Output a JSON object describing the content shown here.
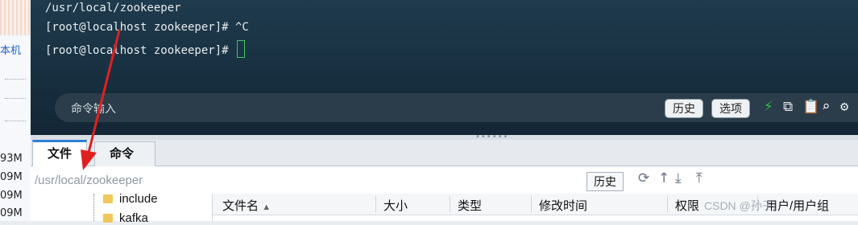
{
  "left_panel": {
    "label": "本机",
    "sizes": [
      "93M",
      "09M",
      "09M",
      "09M"
    ]
  },
  "terminal": {
    "lines": [
      "/usr/local/zookeeper",
      "[root@localhost zookeeper]# ^C",
      "[root@localhost zookeeper]# "
    ],
    "input_placeholder": "命令输入",
    "history_button": "历史",
    "options_button": "选项",
    "icons": [
      "bolt-icon",
      "copy-icon",
      "paste-icon",
      "search-icon",
      "gear-icon"
    ]
  },
  "tabs": [
    {
      "label": "文件",
      "active": true
    },
    {
      "label": "命令",
      "active": false
    }
  ],
  "path_bar": {
    "path": "/usr/local/zookeeper",
    "history_button": "历史",
    "icons": [
      "refresh-icon",
      "up-icon",
      "download-icon",
      "upload-icon"
    ]
  },
  "tree": {
    "items": [
      "include",
      "kafka"
    ]
  },
  "file_table": {
    "columns": [
      "文件名",
      "大小",
      "类型",
      "修改时间",
      "权限",
      "用户/用户组"
    ]
  },
  "watermark": "CSDN @孙子i",
  "colors": {
    "terminal_bg": "#1a3344",
    "cursor": "#38c76a",
    "bolt": "#2ec24f",
    "tab_accent": "#2d7fd9",
    "arrow": "#e02020"
  }
}
